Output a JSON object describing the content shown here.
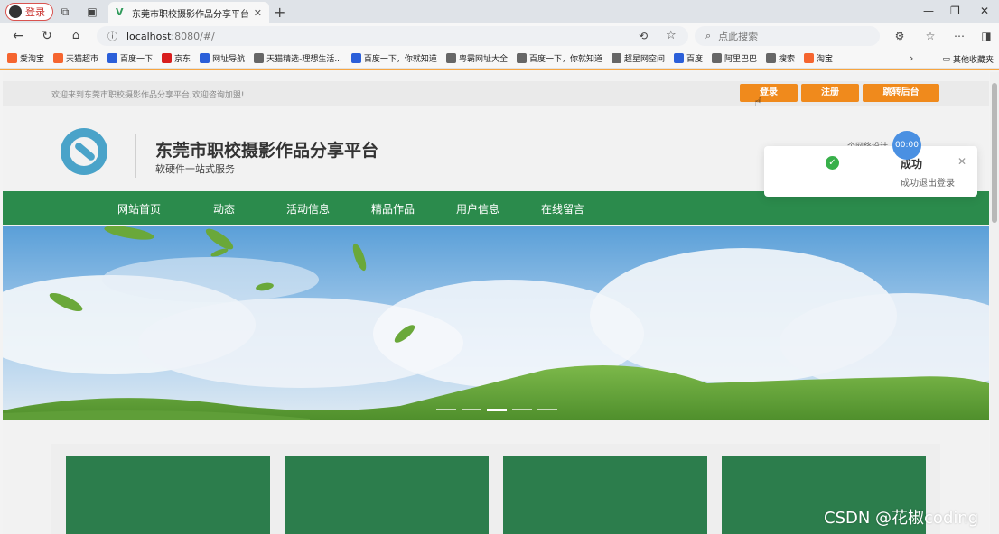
{
  "browser": {
    "profile_label": "登录",
    "tab_title": "东莞市职校摄影作品分享平台",
    "url_host": "localhost",
    "url_path": ":8080/#/",
    "search_placeholder": "点此搜索",
    "bookmarks": [
      {
        "label": "爱淘宝",
        "icon": "taobao-icon",
        "color": "#f5652f"
      },
      {
        "label": "天猫超市",
        "icon": "tmall-icon",
        "color": "#f5652f"
      },
      {
        "label": "百度一下",
        "icon": "baidu-icon",
        "color": "#2b5fd9"
      },
      {
        "label": "京东",
        "icon": "jd-icon",
        "color": "#d81e1e"
      },
      {
        "label": "网址导航",
        "icon": "baidu-icon",
        "color": "#2b5fd9"
      },
      {
        "label": "天猫精选-理想生活...",
        "icon": "globe-icon",
        "color": "#666666"
      },
      {
        "label": "百度一下，你就知道",
        "icon": "baidu-icon",
        "color": "#2b5fd9"
      },
      {
        "label": "粤霸网址大全",
        "icon": "globe-icon",
        "color": "#666666"
      },
      {
        "label": "百度一下，你就知道",
        "icon": "globe-icon",
        "color": "#666666"
      },
      {
        "label": "超星网空间",
        "icon": "chaoxing-icon",
        "color": "#666666"
      },
      {
        "label": "百度",
        "icon": "baidu-icon",
        "color": "#2b5fd9"
      },
      {
        "label": "阿里巴巴",
        "icon": "globe-icon",
        "color": "#666666"
      },
      {
        "label": "搜索",
        "icon": "globe-icon",
        "color": "#666666"
      },
      {
        "label": "淘宝",
        "icon": "taobao-icon",
        "color": "#f5652f"
      }
    ],
    "other_bookmarks": "其他收藏夹"
  },
  "site": {
    "welcome": "欢迎来到东莞市职校摄影作品分享平台,欢迎咨询加盟!",
    "buttons": {
      "login": "登录",
      "register": "注册",
      "admin": "跳转后台"
    },
    "title": "东莞市职校摄影作品分享平台",
    "subtitle": "软硬件一站式服务",
    "nav": [
      "网站首页",
      "动态",
      "活动信息",
      "精品作品",
      "用户信息",
      "在线留言"
    ],
    "hidden_text": "个网络设计"
  },
  "toast": {
    "title": "成功",
    "message": "成功退出登录",
    "timer": "00:00"
  },
  "watermark": "CSDN @花椒coding",
  "colors": {
    "nav_green": "#2b8b4c",
    "card_green": "#2c7d4c",
    "orange": "#f08a1c"
  }
}
